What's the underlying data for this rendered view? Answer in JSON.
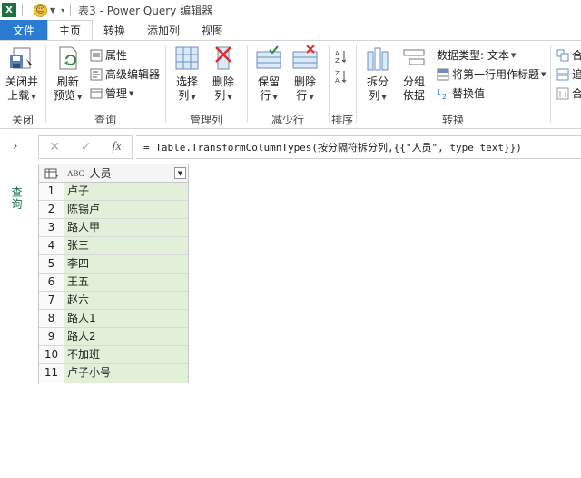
{
  "window": {
    "title": "表3 - Power Query 编辑器",
    "app_icon": "excel-logo"
  },
  "tabs": [
    {
      "label": "文件"
    },
    {
      "label": "主页"
    },
    {
      "label": "转换"
    },
    {
      "label": "添加列"
    },
    {
      "label": "视图"
    }
  ],
  "ribbon": {
    "close": {
      "btn_line1": "关闭并",
      "btn_line2": "上载",
      "group": "关闭"
    },
    "query": {
      "refresh_line1": "刷新",
      "refresh_line2": "预览",
      "properties": "属性",
      "advanced_editor": "高级编辑器",
      "manage": "管理",
      "group": "查询"
    },
    "manage_columns": {
      "select_line1": "选择",
      "select_line2": "列",
      "remove_line1": "删除",
      "remove_line2": "列",
      "group": "管理列"
    },
    "reduce_rows": {
      "keep_line1": "保留",
      "keep_line2": "行",
      "remove_line1": "删除",
      "remove_line2": "行",
      "group": "减少行"
    },
    "sort": {
      "group": "排序"
    },
    "transform": {
      "split_line1": "拆分",
      "split_line2": "列",
      "group_line1": "分组",
      "group_line2": "依据",
      "data_type": "数据类型: 文本",
      "first_row_header": "将第一行用作标题",
      "replace_values": "替换值",
      "group": "转换"
    },
    "combine": {
      "item1": "合",
      "item2": "追",
      "item3": "合"
    }
  },
  "left_pane": {
    "label": "查询"
  },
  "formula": {
    "cancel": "✕",
    "confirm": "✓",
    "fx": "fx",
    "text": "= Table.TransformColumnTypes(按分隔符拆分列,{{\"人员\", type text}})"
  },
  "table": {
    "column": "人员",
    "type_label": "ABC",
    "rows": [
      {
        "n": "1",
        "v": "卢子"
      },
      {
        "n": "2",
        "v": "陈锡卢"
      },
      {
        "n": "3",
        "v": "路人甲"
      },
      {
        "n": "4",
        "v": "张三"
      },
      {
        "n": "5",
        "v": "李四"
      },
      {
        "n": "6",
        "v": "王五"
      },
      {
        "n": "7",
        "v": "赵六"
      },
      {
        "n": "8",
        "v": "路人1"
      },
      {
        "n": "9",
        "v": "路人2"
      },
      {
        "n": "10",
        "v": "不加班"
      },
      {
        "n": "11",
        "v": "卢子小号"
      }
    ]
  },
  "colors": {
    "accent": "#2b7bd5",
    "excel_green": "#1e7145",
    "cell_fill": "#e2f0d9"
  }
}
